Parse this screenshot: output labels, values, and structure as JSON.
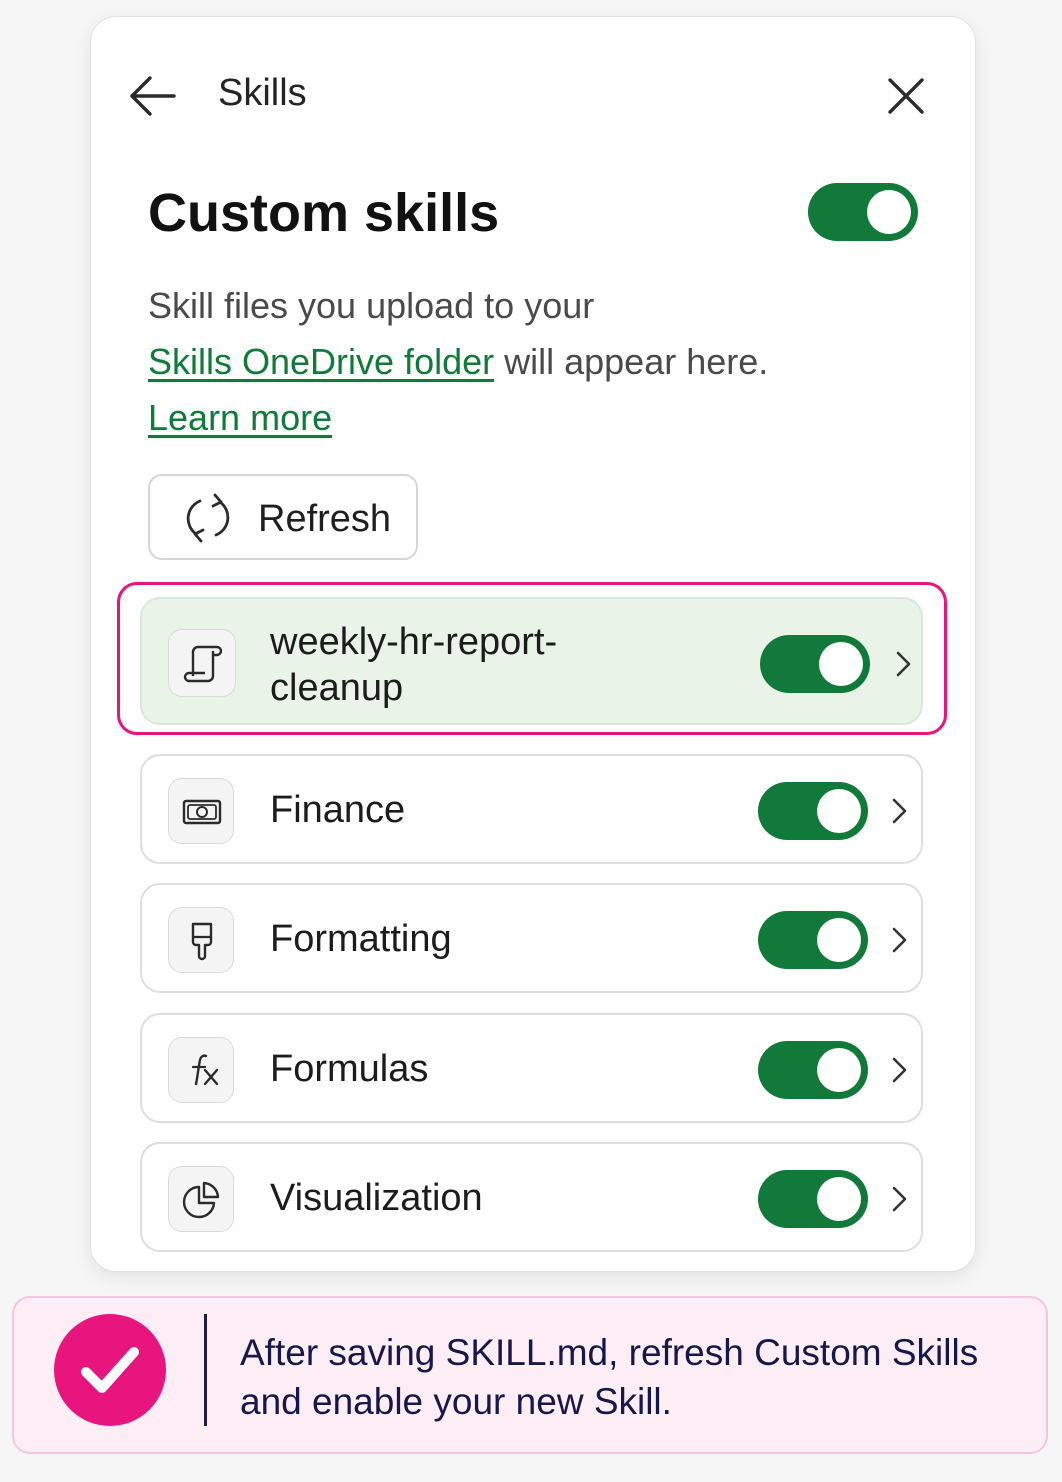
{
  "header": {
    "title": "Skills",
    "back_icon": "arrow-left-icon",
    "close_icon": "close-icon"
  },
  "custom_skills": {
    "title": "Custom skills",
    "enabled": true,
    "desc_part1": "Skill files you upload to your",
    "link_folder": "Skills OneDrive folder",
    "desc_part2": " will appear here.",
    "link_learn": "Learn more",
    "refresh_label": "Refresh"
  },
  "skills": [
    {
      "name": "weekly-hr-report-cleanup",
      "icon": "script-scroll-icon",
      "enabled": true,
      "highlighted": true
    },
    {
      "name": "Finance",
      "icon": "money-icon",
      "enabled": true
    },
    {
      "name": "Formatting",
      "icon": "paintbrush-icon",
      "enabled": true
    },
    {
      "name": "Formulas",
      "icon": "function-fx-icon",
      "enabled": true
    },
    {
      "name": "Visualization",
      "icon": "pie-chart-icon",
      "enabled": true
    }
  ],
  "tip": {
    "line1": "After saving SKILL.md, refresh Custom Skills",
    "line2": "and enable your new Skill."
  },
  "colors": {
    "accent_green": "#117a3a",
    "link_green": "#0f7b38",
    "highlight_pink": "#e6157f",
    "active_row_bg": "#e9f3e8"
  }
}
